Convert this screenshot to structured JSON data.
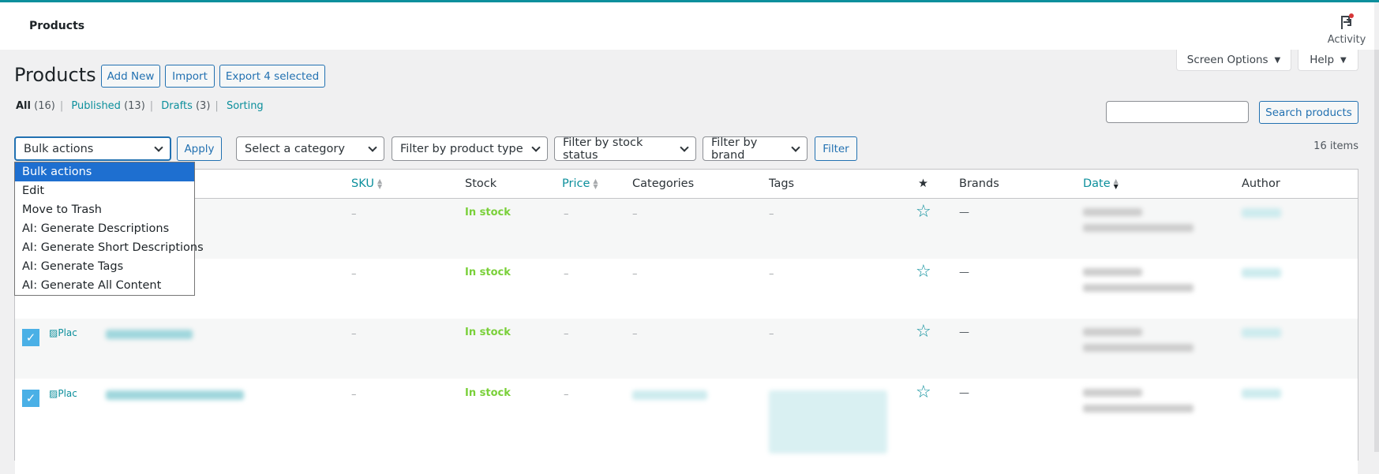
{
  "header": {
    "title": "Products",
    "activity_label": "Activity"
  },
  "screen_options": "Screen Options",
  "help": "Help",
  "page_title": "Products",
  "actions": {
    "add_new": "Add New",
    "import": "Import",
    "export": "Export 4 selected"
  },
  "views": [
    {
      "label": "All",
      "count": "(16)"
    },
    {
      "label": "Published",
      "count": "(13)"
    },
    {
      "label": "Drafts",
      "count": "(3)"
    },
    {
      "label": "Sorting",
      "count": ""
    }
  ],
  "search": {
    "value": "",
    "button": "Search products"
  },
  "filters": {
    "bulk": "Bulk actions",
    "apply": "Apply",
    "category": "Select a category",
    "product_type": "Filter by product type",
    "stock_status": "Filter by stock status",
    "brand": "Filter by brand",
    "filter": "Filter"
  },
  "items_count": "16 items",
  "bulk_options": [
    "Bulk actions",
    "Edit",
    "Move to Trash",
    "AI: Generate Descriptions",
    "AI: Generate Short Descriptions",
    "AI: Generate Tags",
    "AI: Generate All Content"
  ],
  "columns": {
    "sku": "SKU",
    "stock": "Stock",
    "price": "Price",
    "categories": "Categories",
    "tags": "Tags",
    "featured": "★",
    "brands": "Brands",
    "date": "Date",
    "author": "Author"
  },
  "rows": [
    {
      "checked": false,
      "sku": "–",
      "stock": "In stock",
      "price": "–",
      "categories": "–",
      "tags": "–",
      "brands": "—"
    },
    {
      "checked": false,
      "sku": "–",
      "stock": "In stock",
      "price": "–",
      "categories": "–",
      "tags": "–",
      "brands": "—"
    },
    {
      "checked": true,
      "thumb": "Plac",
      "sku": "–",
      "stock": "In stock",
      "price": "–",
      "categories": "–",
      "tags": "–",
      "brands": "—"
    },
    {
      "checked": true,
      "thumb": "Plac",
      "sku": "–",
      "stock": "In stock",
      "price": "–",
      "categories": "",
      "tags": "",
      "brands": "—"
    }
  ],
  "colors": {
    "accent": "#0c8f9c",
    "in_stock": "#7ad03a",
    "checkbox": "#4ab0e6",
    "selected_option": "#1e6fd0"
  }
}
